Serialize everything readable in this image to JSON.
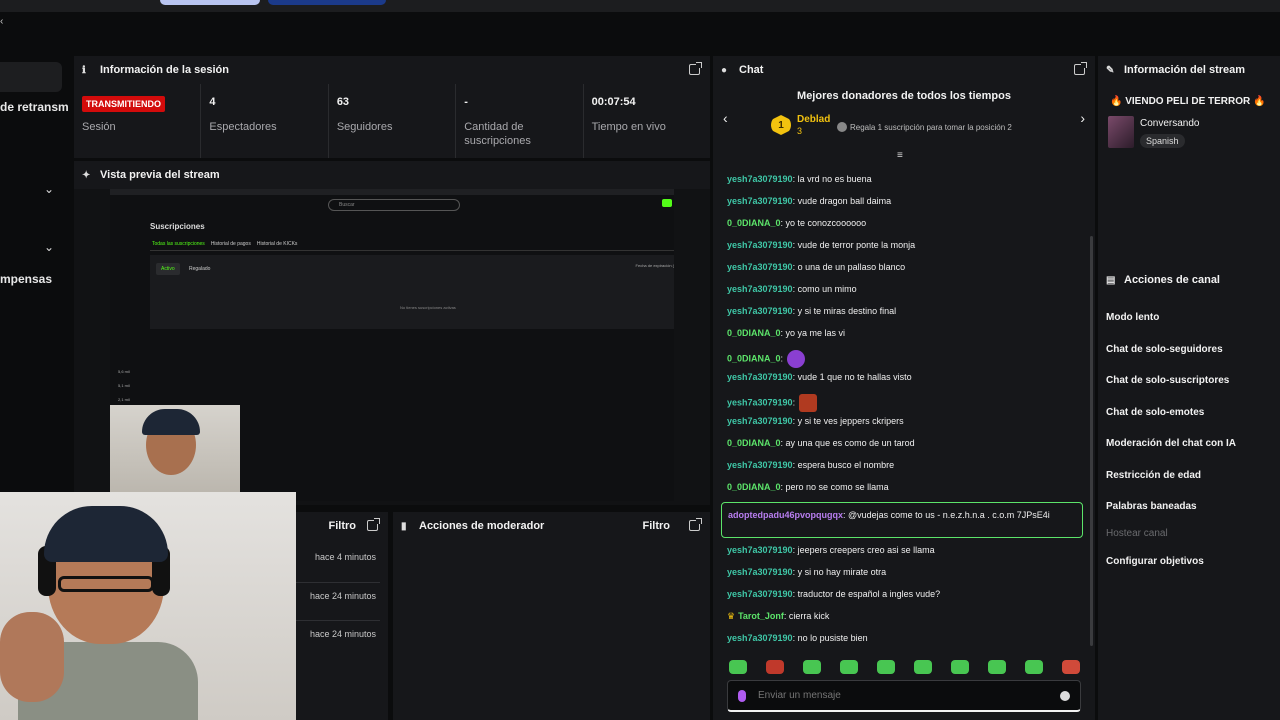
{
  "left_nav": {
    "item1": "de retransm",
    "item2": "mpensas"
  },
  "session": {
    "title": "Información de la sesión",
    "status_badge": "TRANSMITIENDO",
    "status_label": "Sesión",
    "viewers_value": "4",
    "viewers_label": "Espectadores",
    "followers_value": "63",
    "followers_label": "Seguidores",
    "subs_value": "-",
    "subs_label": "Cantidad de suscripciones",
    "uptime_value": "00:07:54",
    "uptime_label": "Tiempo en vivo"
  },
  "preview": {
    "title": "Vista previa del stream",
    "search": "Buscar",
    "page_title": "Suscripciones",
    "tabs": [
      "Todas las suscripciones",
      "Historial de pagos",
      "Historial de KICKs"
    ],
    "btn_active": "Activo",
    "btn_gift": "Regalado",
    "col_right": "Fecha de expiración (",
    "empty": "No tienes suscripciones activas",
    "side1": "5,6 mil",
    "side2": "5,1 mil",
    "side3": "2,1 mil"
  },
  "bottom_left": {
    "filter": "Filtro",
    "times": [
      "hace 4 minutos",
      "hace 24 minutos",
      "hace 24 minutos"
    ]
  },
  "mod_actions": {
    "title": "Acciones de moderador",
    "filter": "Filtro"
  },
  "chat": {
    "title": "Chat",
    "top_donors": "Mejores donadores de todos los tiempos",
    "donor_name": "Deblad",
    "donor_rank": "1",
    "donor_amount": "3",
    "gift_text": "Regala 1 suscripción para tomar la posición 2",
    "messages": [
      {
        "user": "yesh7a3079190",
        "text": ": la vrd no es buena"
      },
      {
        "user": "yesh7a3079190",
        "text": ": vude dragon ball daima"
      },
      {
        "user": "0_0DIANA_0",
        "text": ": yo te conozcoooooo"
      },
      {
        "user": "yesh7a3079190",
        "text": ": vude de terror ponte la monja"
      },
      {
        "user": "yesh7a3079190",
        "text": ": o una de un pallaso blanco"
      },
      {
        "user": "yesh7a3079190",
        "text": ": como un mimo"
      },
      {
        "user": "yesh7a3079190",
        "text": ": y si te miras destino final"
      },
      {
        "user": "0_0DIANA_0",
        "text": ": yo ya me las vi"
      },
      {
        "user": "0_0DIANA_0",
        "text": ":"
      },
      {
        "user": "yesh7a3079190",
        "text": ": vude 1 que no te hallas visto"
      },
      {
        "user": "yesh7a3079190",
        "text": ":"
      },
      {
        "user": "yesh7a3079190",
        "text": ": y si te ves jeppers ckripers"
      },
      {
        "user": "0_0DIANA_0",
        "text": ": ay una que es como de un tarod"
      },
      {
        "user": "yesh7a3079190",
        "text": ": espera busco el nombre"
      },
      {
        "user": "0_0DIANA_0",
        "text": ": pero no se como se llama"
      }
    ],
    "highlight_user": "adoptedpadu46pvopqugqx",
    "highlight_text": ": @vudejas come to us - n.e.z.h.n.a . c.o.m 7JPsE4i",
    "messages2": [
      {
        "user": "yesh7a3079190",
        "text": ": jeepers creepers creo asi se llama"
      },
      {
        "user": "yesh7a3079190",
        "text": ": y si no hay mirate otra"
      },
      {
        "user": "yesh7a3079190",
        "text": ": traductor de español a ingles vude?"
      },
      {
        "user": "Tarot_Jonf",
        "text": ": cierra kick"
      },
      {
        "user": "yesh7a3079190",
        "text": ": no lo pusiste bien"
      }
    ],
    "input_placeholder": "Enviar un mensaje"
  },
  "stream_info": {
    "title": "Información del stream",
    "stream_title": "🔥 VIENDO PELI DE TERROR 🔥",
    "category": "Conversando",
    "language": "Spanish"
  },
  "channel_actions": {
    "title": "Acciones de canal",
    "items": [
      "Modo lento",
      "Chat de solo-seguidores",
      "Chat de solo-suscriptores",
      "Chat de solo-emotes",
      "Moderación del chat con IA",
      "Restricción de edad",
      "Palabras baneadas",
      "Hostear canal",
      "Configurar objetivos"
    ]
  },
  "colors": {
    "live_red": "#d30b0b",
    "kick_green": "#53fc18",
    "username_teal": "#3fc7a7",
    "username_green": "#5ce46a",
    "donor_gold": "#f2c20f"
  }
}
